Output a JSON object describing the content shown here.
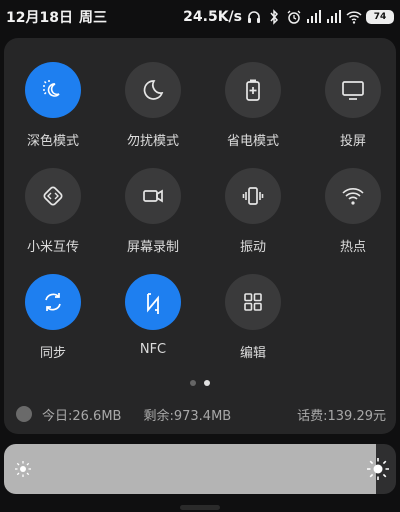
{
  "status": {
    "date": "12月18日",
    "weekday": "周三",
    "speed": "24.5K/s",
    "battery": "74"
  },
  "tiles": [
    {
      "label": "深色模式",
      "icon": "dark-mode-icon",
      "active": true
    },
    {
      "label": "勿扰模式",
      "icon": "moon-icon",
      "active": false
    },
    {
      "label": "省电模式",
      "icon": "battery-saver-icon",
      "active": false
    },
    {
      "label": "投屏",
      "icon": "cast-screen-icon",
      "active": false
    },
    {
      "label": "小米互传",
      "icon": "mi-share-icon",
      "active": false
    },
    {
      "label": "屏幕录制",
      "icon": "screen-record-icon",
      "active": false
    },
    {
      "label": "振动",
      "icon": "vibrate-icon",
      "active": false
    },
    {
      "label": "热点",
      "icon": "hotspot-icon",
      "active": false
    },
    {
      "label": "同步",
      "icon": "sync-icon",
      "active": true
    },
    {
      "label": "NFC",
      "icon": "nfc-icon",
      "active": true
    },
    {
      "label": "编辑",
      "icon": "edit-grid-icon",
      "active": false
    }
  ],
  "pager": {
    "pages": 2,
    "current": 2
  },
  "data_usage": {
    "today": "今日:26.6MB",
    "remaining": "剩余:973.4MB",
    "balance": "话费:139.29元"
  },
  "brightness": {
    "level": 0.95
  },
  "colors": {
    "accent": "#1e7ff0",
    "panel": "#262627",
    "tile": "#3a3a3b"
  }
}
